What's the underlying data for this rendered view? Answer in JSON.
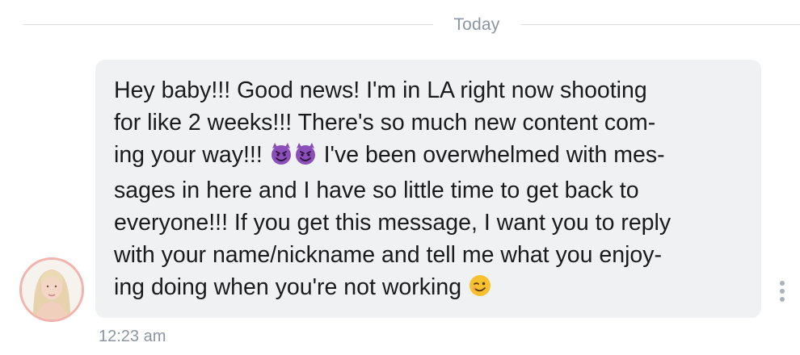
{
  "divider": {
    "label": "Today"
  },
  "message": {
    "lines": [
      "Hey baby!!! Good news! I'm in LA right now shooting",
      "for like 2 weeks!!! There's so much new content com-",
      "ing your way!!! ",
      " I've been overwhelmed with mes-",
      "sages in here and I have so little time to get back to",
      "everyone!!! If you get this message, I want you to reply",
      "with your name/nickname and tell me what you enjoy-",
      "ing doing when you're not working "
    ],
    "emojis": {
      "devil": "smiling-face-with-horns-icon",
      "wink": "winking-face-icon"
    },
    "timestamp": "12:23 am"
  },
  "colors": {
    "bubble_bg": "#f0f1f3",
    "text": "#1b1b1b",
    "muted": "#8a96a3",
    "avatar_ring": "#f2b3ad",
    "devil_purple": "#8a4fb8"
  },
  "icons": {
    "menu": "more-vertical-icon",
    "avatar": "avatar"
  }
}
